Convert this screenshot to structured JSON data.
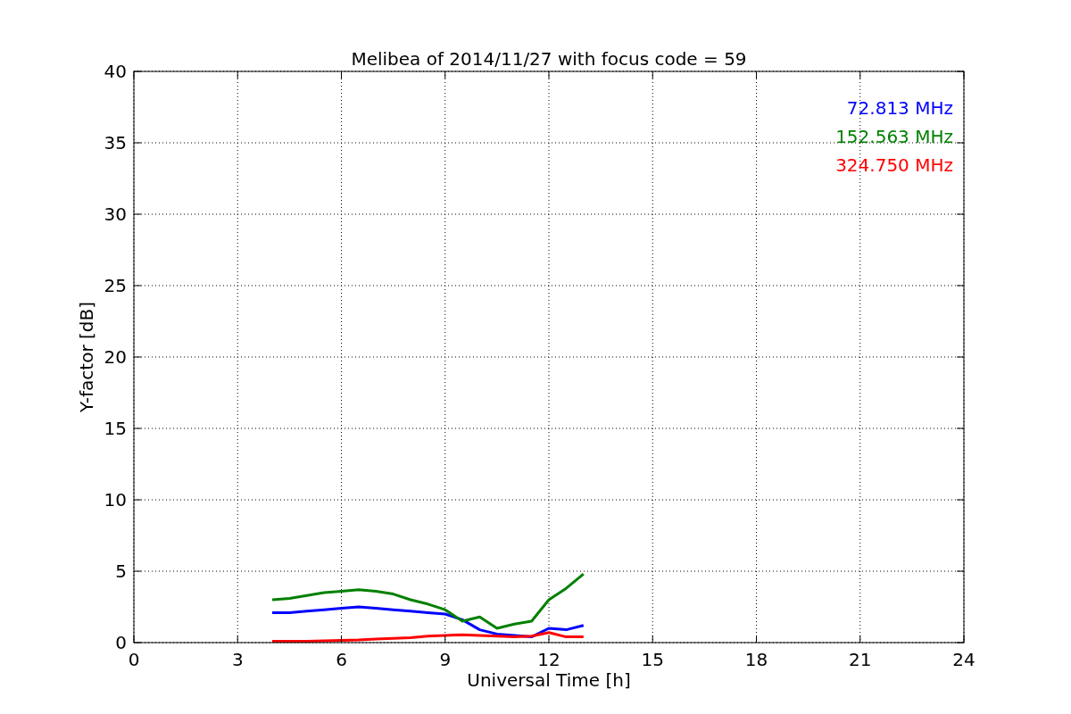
{
  "chart_data": {
    "type": "line",
    "title": "Melibea of 2014/11/27 with focus code = 59",
    "xlabel": "Universal Time [h]",
    "ylabel": "Y-factor [dB]",
    "x": [
      4,
      4.5,
      5,
      5.5,
      6,
      6.5,
      7,
      7.5,
      8,
      8.5,
      9,
      9.5,
      10,
      10.5,
      11,
      11.5,
      12,
      12.5,
      13
    ],
    "series": [
      {
        "name": "72.813 MHz",
        "color": "#0000ff",
        "values": [
          2.1,
          2.1,
          2.2,
          2.3,
          2.4,
          2.5,
          2.4,
          2.3,
          2.2,
          2.1,
          2.0,
          1.6,
          0.9,
          0.6,
          0.5,
          0.4,
          1.0,
          0.9,
          1.2
        ]
      },
      {
        "name": "152.563 MHz",
        "color": "#008000",
        "values": [
          3.0,
          3.1,
          3.3,
          3.5,
          3.6,
          3.7,
          3.6,
          3.4,
          3.0,
          2.7,
          2.3,
          1.5,
          1.8,
          1.0,
          1.3,
          1.5,
          3.0,
          3.8,
          4.8
        ]
      },
      {
        "name": "324.750 MHz",
        "color": "#ff0000",
        "values": [
          0.1,
          0.1,
          0.1,
          0.12,
          0.15,
          0.18,
          0.25,
          0.3,
          0.35,
          0.45,
          0.5,
          0.55,
          0.5,
          0.45,
          0.4,
          0.45,
          0.7,
          0.4,
          0.4
        ]
      }
    ],
    "grid": true,
    "xlim": [
      0,
      24
    ],
    "ylim": [
      0,
      40
    ],
    "xticks": [
      0,
      3,
      6,
      9,
      12,
      15,
      18,
      21,
      24
    ],
    "yticks": [
      0,
      5,
      10,
      15,
      20,
      25,
      30,
      35,
      40
    ]
  }
}
